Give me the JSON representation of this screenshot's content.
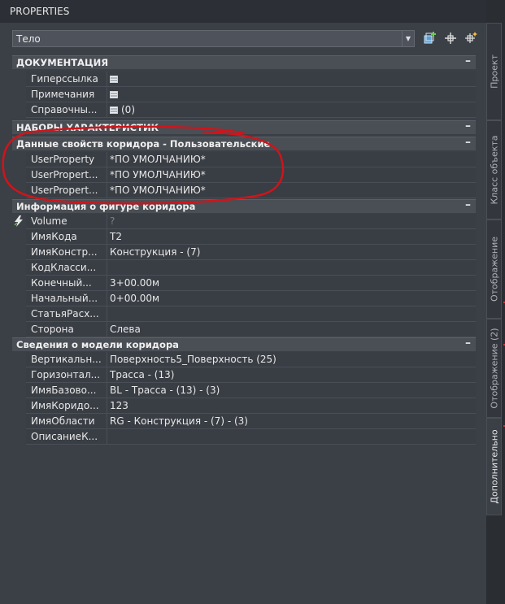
{
  "window": {
    "title": "PROPERTIES"
  },
  "object_selector": {
    "value": "Тело"
  },
  "toolbar": {
    "icons": [
      "quick-select-icon",
      "pickadd-icon",
      "select-objects-icon"
    ]
  },
  "sections": [
    {
      "label": "ДОКУМЕНТАЦИЯ",
      "collapse": "–"
    },
    {
      "label": "НАБОРЫ ХАРАКТЕРИСТИК",
      "collapse": "–"
    },
    {
      "label": "Данные свойств коридора - Пользовательские",
      "collapse": "–"
    },
    {
      "label": "Информация о фигуре коридора",
      "collapse": "–"
    },
    {
      "label": "Сведения о модели коридора",
      "collapse": "–"
    }
  ],
  "documentation": [
    {
      "name": "Гиперссылка",
      "value": ""
    },
    {
      "name": "Примечания",
      "value": ""
    },
    {
      "name": "Справочны...",
      "value": "(0)"
    }
  ],
  "user_props": [
    {
      "name": "UserProperty",
      "value": "*ПО УМОЛЧАНИЮ*"
    },
    {
      "name": "UserPropert...",
      "value": "*ПО УМОЛЧАНИЮ*"
    },
    {
      "name": "UserPropert...",
      "value": "*ПО УМОЛЧАНИЮ*"
    }
  ],
  "shape_info": [
    {
      "name": "Volume",
      "value": "?"
    },
    {
      "name": "ИмяКода",
      "value": "T2"
    },
    {
      "name": "ИмяКонстр...",
      "value": "Конструкция - (7)"
    },
    {
      "name": "КодКласси...",
      "value": ""
    },
    {
      "name": "Конечный...",
      "value": "3+00.00м"
    },
    {
      "name": "Начальный...",
      "value": "0+00.00м"
    },
    {
      "name": "СтатьяРасх...",
      "value": ""
    },
    {
      "name": "Сторона",
      "value": "Слева"
    }
  ],
  "model_info": [
    {
      "name": "Вертикальн...",
      "value": "Поверхность5_Поверхность (25)"
    },
    {
      "name": "Горизонтал...",
      "value": "Трасса - (13)"
    },
    {
      "name": "ИмяБазово...",
      "value": "BL - Трасса - (13) - (3)"
    },
    {
      "name": "ИмяКоридо...",
      "value": "123"
    },
    {
      "name": "ИмяОбласти",
      "value": "RG - Конструкция - (7) - (3)"
    },
    {
      "name": "ОписаниеК...",
      "value": ""
    }
  ],
  "side_tabs": [
    {
      "label": "Проект"
    },
    {
      "label": "Класс объекта"
    },
    {
      "label": "Отображение"
    },
    {
      "label": "Отображение (2)"
    },
    {
      "label": "Дополнительно"
    }
  ],
  "colors": {
    "panel": "#3b3f46",
    "section": "#4a4e55",
    "annotation": "#d0141a"
  }
}
